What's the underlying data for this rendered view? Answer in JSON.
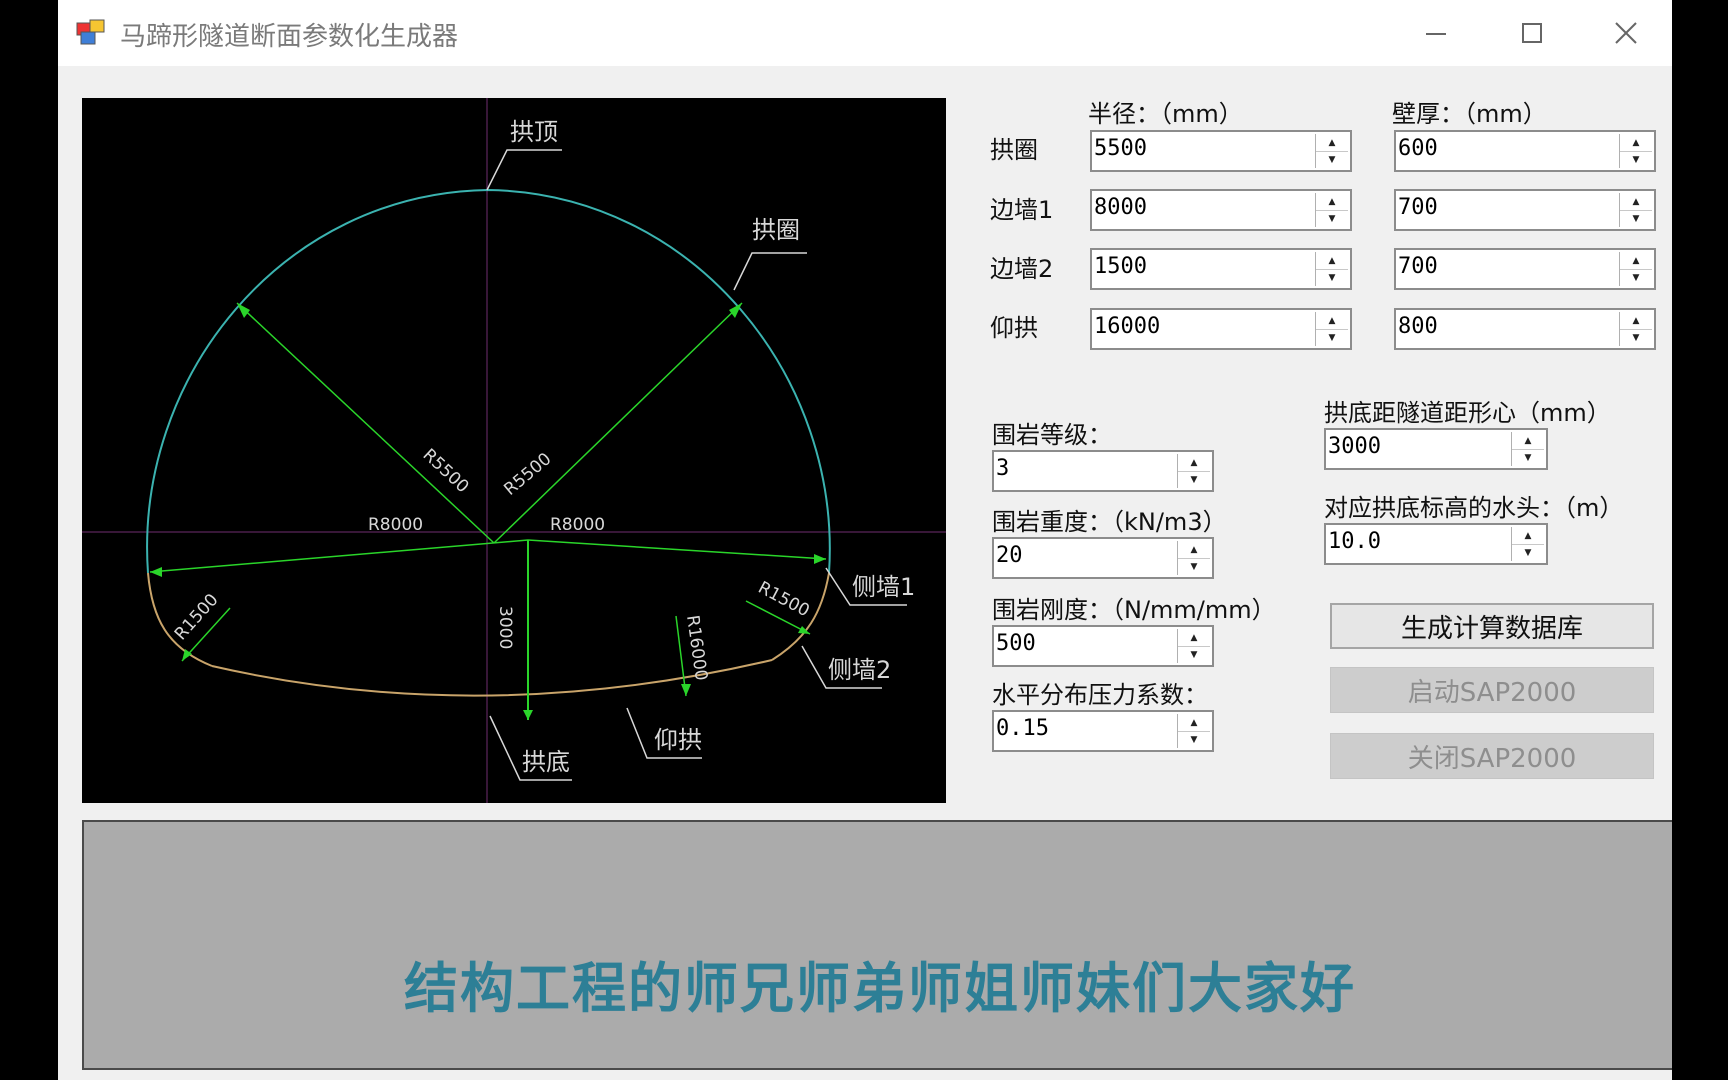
{
  "window": {
    "title": "马蹄形隧道断面参数化生成器",
    "controls": {
      "minimize_glyph": "—",
      "maximize_glyph": "☐",
      "close_glyph": "✕"
    }
  },
  "drawing": {
    "labels": {
      "crown": "拱顶",
      "arch": "拱圈",
      "side_wall_1": "侧墙1",
      "side_wall_2": "侧墙2",
      "invert": "仰拱",
      "arch_bottom": "拱底",
      "r5500_left": "R5500",
      "r5500_right": "R5500",
      "r8000_left": "R8000",
      "r8000_right": "R8000",
      "r1500_left": "R1500",
      "r1500_right": "R1500",
      "r16000": "R16000",
      "dim_3000": "3000"
    },
    "colors": {
      "arch": "#3bb3b0",
      "invert": "#c9a46a",
      "dimension": "#2ad52a",
      "label": "#d8d8d8",
      "axis": "#3a1a3a"
    }
  },
  "params": {
    "radius_header": "半径：（mm）",
    "thickness_header": "壁厚：（mm）",
    "rows": [
      {
        "label": "拱圈",
        "radius": "5500",
        "thickness": "600"
      },
      {
        "label": "边墙1",
        "radius": "8000",
        "thickness": "700"
      },
      {
        "label": "边墙2",
        "radius": "1500",
        "thickness": "700"
      },
      {
        "label": "仰拱",
        "radius": "16000",
        "thickness": "800"
      }
    ]
  },
  "rock": {
    "grade_label": "围岩等级：",
    "grade_value": "3",
    "unit_weight_label": "围岩重度：（kN/m3）",
    "unit_weight_value": "20",
    "stiffness_label": "围岩刚度：（N/mm/mm）",
    "stiffness_value": "500",
    "lateral_coeff_label": "水平分布压力系数：",
    "lateral_coeff_value": "0.15"
  },
  "geometry": {
    "offset_label": "拱底距隧道距形心（mm）",
    "offset_value": "3000",
    "water_head_label": "对应拱底标高的水头：（m）",
    "water_head_value": "10.0"
  },
  "actions": {
    "generate_label": "生成计算数据库",
    "start_sap_label": "启动SAP2000",
    "close_sap_label": "关闭SAP2000"
  },
  "subtitle": "结构工程的师兄师弟师姐师妹们大家好"
}
